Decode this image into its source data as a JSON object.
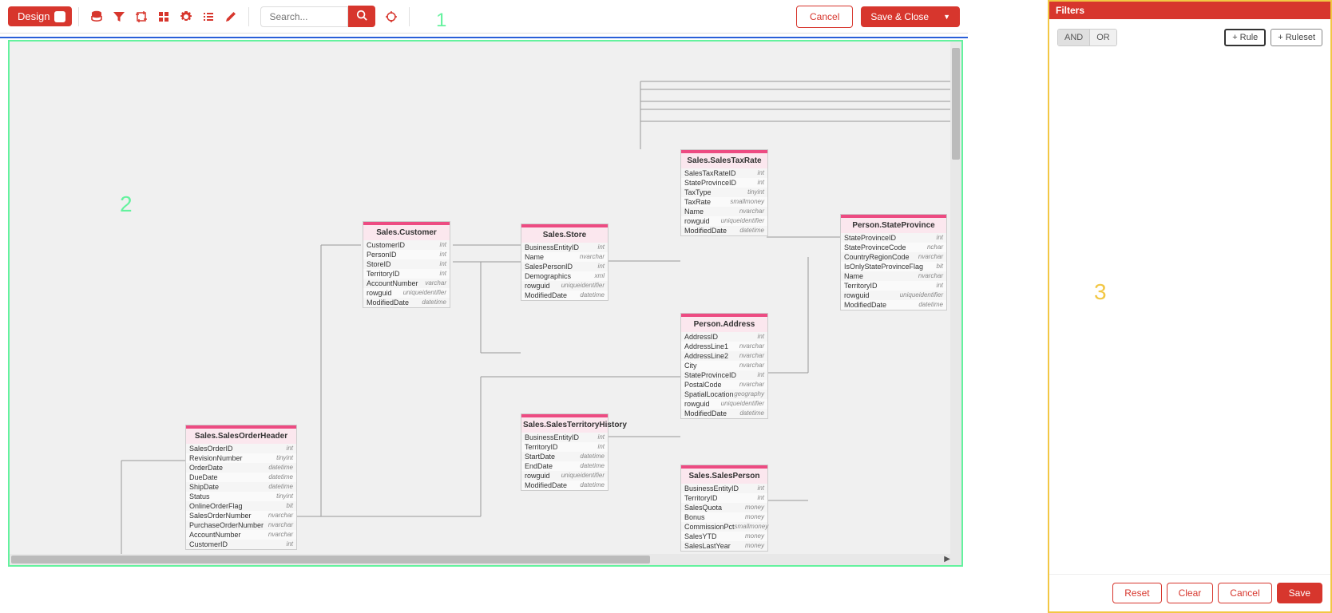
{
  "toolbar": {
    "design_label": "Design",
    "search_placeholder": "Search...",
    "cancel_label": "Cancel",
    "save_close_label": "Save & Close"
  },
  "overlay": {
    "one": "1",
    "two": "2",
    "three": "3"
  },
  "tables": {
    "customer": {
      "title": "Sales.Customer",
      "cols": [
        {
          "n": "CustomerID",
          "t": "int"
        },
        {
          "n": "PersonID",
          "t": "int"
        },
        {
          "n": "StoreID",
          "t": "int"
        },
        {
          "n": "TerritoryID",
          "t": "int"
        },
        {
          "n": "AccountNumber",
          "t": "varchar"
        },
        {
          "n": "rowguid",
          "t": "uniqueidentifier"
        },
        {
          "n": "ModifiedDate",
          "t": "datetime"
        }
      ]
    },
    "store": {
      "title": "Sales.Store",
      "cols": [
        {
          "n": "BusinessEntityID",
          "t": "int"
        },
        {
          "n": "Name",
          "t": "nvarchar"
        },
        {
          "n": "SalesPersonID",
          "t": "int"
        },
        {
          "n": "Demographics",
          "t": "xml"
        },
        {
          "n": "rowguid",
          "t": "uniqueidentifier"
        },
        {
          "n": "ModifiedDate",
          "t": "datetime"
        }
      ]
    },
    "taxrate": {
      "title": "Sales.SalesTaxRate",
      "cols": [
        {
          "n": "SalesTaxRateID",
          "t": "int"
        },
        {
          "n": "StateProvinceID",
          "t": "int"
        },
        {
          "n": "TaxType",
          "t": "tinyint"
        },
        {
          "n": "TaxRate",
          "t": "smallmoney"
        },
        {
          "n": "Name",
          "t": "nvarchar"
        },
        {
          "n": "rowguid",
          "t": "uniqueidentifier"
        },
        {
          "n": "ModifiedDate",
          "t": "datetime"
        }
      ]
    },
    "stateprov": {
      "title": "Person.StateProvince",
      "cols": [
        {
          "n": "StateProvinceID",
          "t": "int"
        },
        {
          "n": "StateProvinceCode",
          "t": "nchar"
        },
        {
          "n": "CountryRegionCode",
          "t": "nvarchar"
        },
        {
          "n": "IsOnlyStateProvinceFlag",
          "t": "bit"
        },
        {
          "n": "Name",
          "t": "nvarchar"
        },
        {
          "n": "TerritoryID",
          "t": "int"
        },
        {
          "n": "rowguid",
          "t": "uniqueidentifier"
        },
        {
          "n": "ModifiedDate",
          "t": "datetime"
        }
      ]
    },
    "address": {
      "title": "Person.Address",
      "cols": [
        {
          "n": "AddressID",
          "t": "int"
        },
        {
          "n": "AddressLine1",
          "t": "nvarchar"
        },
        {
          "n": "AddressLine2",
          "t": "nvarchar"
        },
        {
          "n": "City",
          "t": "nvarchar"
        },
        {
          "n": "StateProvinceID",
          "t": "int"
        },
        {
          "n": "PostalCode",
          "t": "nvarchar"
        },
        {
          "n": "SpatialLocation",
          "t": "geography"
        },
        {
          "n": "rowguid",
          "t": "uniqueidentifier"
        },
        {
          "n": "ModifiedDate",
          "t": "datetime"
        }
      ]
    },
    "terrhist": {
      "title": "Sales.SalesTerritoryHistory",
      "cols": [
        {
          "n": "BusinessEntityID",
          "t": "int"
        },
        {
          "n": "TerritoryID",
          "t": "int"
        },
        {
          "n": "StartDate",
          "t": "datetime"
        },
        {
          "n": "EndDate",
          "t": "datetime"
        },
        {
          "n": "rowguid",
          "t": "uniqueidentifier"
        },
        {
          "n": "ModifiedDate",
          "t": "datetime"
        }
      ]
    },
    "salesperson": {
      "title": "Sales.SalesPerson",
      "cols": [
        {
          "n": "BusinessEntityID",
          "t": "int"
        },
        {
          "n": "TerritoryID",
          "t": "int"
        },
        {
          "n": "SalesQuota",
          "t": "money"
        },
        {
          "n": "Bonus",
          "t": "money"
        },
        {
          "n": "CommissionPct",
          "t": "smallmoney"
        },
        {
          "n": "SalesYTD",
          "t": "money"
        },
        {
          "n": "SalesLastYear",
          "t": "money"
        }
      ]
    },
    "soh": {
      "title": "Sales.SalesOrderHeader",
      "cols": [
        {
          "n": "SalesOrderID",
          "t": "int"
        },
        {
          "n": "RevisionNumber",
          "t": "tinyint"
        },
        {
          "n": "OrderDate",
          "t": "datetime"
        },
        {
          "n": "DueDate",
          "t": "datetime"
        },
        {
          "n": "ShipDate",
          "t": "datetime"
        },
        {
          "n": "Status",
          "t": "tinyint"
        },
        {
          "n": "OnlineOrderFlag",
          "t": "bit"
        },
        {
          "n": "SalesOrderNumber",
          "t": "nvarchar"
        },
        {
          "n": "PurchaseOrderNumber",
          "t": "nvarchar"
        },
        {
          "n": "AccountNumber",
          "t": "nvarchar"
        },
        {
          "n": "CustomerID",
          "t": "int"
        }
      ]
    }
  },
  "filters": {
    "title": "Filters",
    "and": "AND",
    "or": "OR",
    "rule": "Rule",
    "ruleset": "Ruleset",
    "reset": "Reset",
    "clear": "Clear",
    "cancel": "Cancel",
    "save": "Save"
  }
}
